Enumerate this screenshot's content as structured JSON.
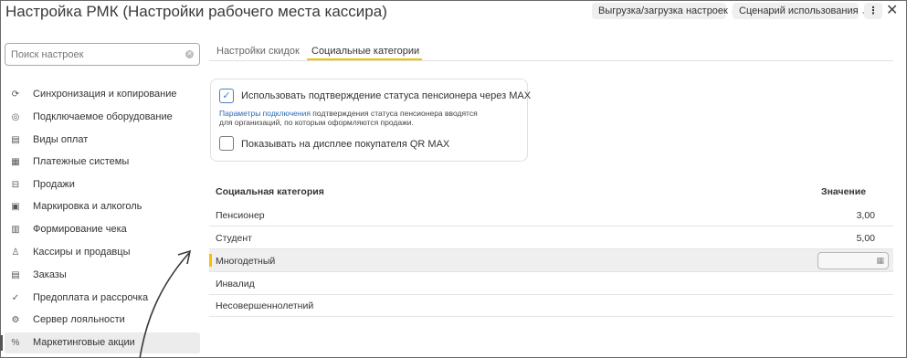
{
  "window": {
    "title": "Настройка РМК (Настройки рабочего места кассира)",
    "export_button": "Выгрузка/загрузка настроек",
    "scenario_button": "Сценарий использования",
    "more_icon": "more-vertical-icon",
    "close_icon": "close-icon"
  },
  "search": {
    "placeholder": "Поиск настроек"
  },
  "sidebar": {
    "items": [
      {
        "label": "Синхронизация и копирование",
        "icon": "sync-icon",
        "glyph": "⟳"
      },
      {
        "label": "Подключаемое оборудование",
        "icon": "device-icon",
        "glyph": "◎"
      },
      {
        "label": "Виды оплат",
        "icon": "payment-icon",
        "glyph": "▤"
      },
      {
        "label": "Платежные системы",
        "icon": "payment-systems-icon",
        "glyph": "▦"
      },
      {
        "label": "Продажи",
        "icon": "sales-icon",
        "glyph": "⊟"
      },
      {
        "label": "Маркировка и алкоголь",
        "icon": "marking-icon",
        "glyph": "▣"
      },
      {
        "label": "Формирование чека",
        "icon": "receipt-icon",
        "glyph": "▥"
      },
      {
        "label": "Кассиры и продавцы",
        "icon": "cashiers-icon",
        "glyph": "♙"
      },
      {
        "label": "Заказы",
        "icon": "orders-icon",
        "glyph": "▤"
      },
      {
        "label": "Предоплата и рассрочка",
        "icon": "prepayment-icon",
        "glyph": "✓"
      },
      {
        "label": "Сервер лояльности",
        "icon": "gear-icon",
        "glyph": "⚙"
      },
      {
        "label": "Маркетинговые акции",
        "icon": "percent-icon",
        "glyph": "%"
      }
    ]
  },
  "tabs": [
    {
      "label": "Настройки скидок"
    },
    {
      "label": "Социальные категории"
    }
  ],
  "panel": {
    "use_max_label": "Использовать подтверждение статуса пенсионера через MAX",
    "use_max_checked": true,
    "hint_link": "Параметры подключения",
    "hint_text1": " подтверждения статуса пенсионера вводятся",
    "hint_text2": "для организаций, по которым оформляются продажи.",
    "show_qr_label": "Показывать на дисплее покупателя QR MAX",
    "show_qr_checked": false
  },
  "grid": {
    "col_category": "Социальная категория",
    "col_value": "Значение",
    "rows": [
      {
        "category": "Пенсионер",
        "value": "3,00"
      },
      {
        "category": "Студент",
        "value": "5,00"
      },
      {
        "category": "Многодетный",
        "value": ""
      },
      {
        "category": "Инвалид",
        "value": ""
      },
      {
        "category": "Несовершеннолетний",
        "value": ""
      }
    ]
  }
}
